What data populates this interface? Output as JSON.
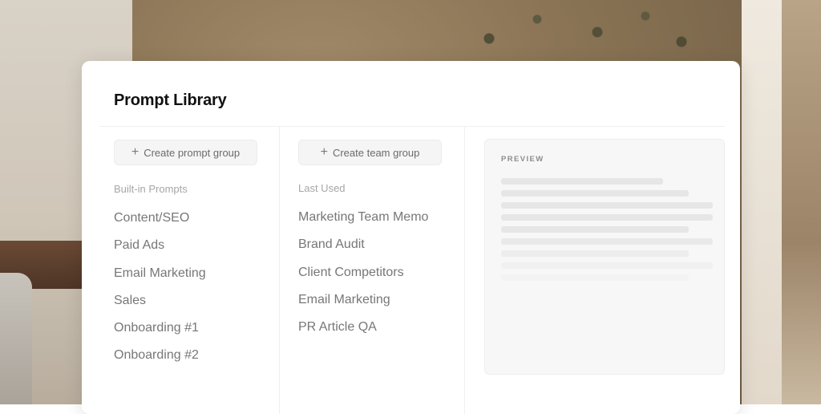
{
  "card": {
    "title": "Prompt Library"
  },
  "left_column": {
    "create_button_label": "Create prompt group",
    "section_label": "Built-in Prompts",
    "items": [
      "Content/SEO",
      "Paid Ads",
      "Email Marketing",
      "Sales",
      "Onboarding #1",
      "Onboarding #2"
    ]
  },
  "middle_column": {
    "create_button_label": "Create team group",
    "section_label": "Last Used",
    "items": [
      "Marketing Team Memo",
      "Brand Audit",
      "Client Competitors",
      "Email Marketing",
      "PR Article QA"
    ]
  },
  "preview": {
    "label": "PREVIEW"
  },
  "icons": {
    "create_prompt_group": "plus-icon",
    "create_team_group": "plus-icon"
  },
  "colors": {
    "card_background": "#ffffff",
    "title_text": "#111111",
    "item_text": "#777777",
    "section_label_text": "#a6a6a6",
    "button_background": "#f5f5f5",
    "preview_background": "#f7f7f7",
    "skeleton_line": "#e6e6e6"
  }
}
